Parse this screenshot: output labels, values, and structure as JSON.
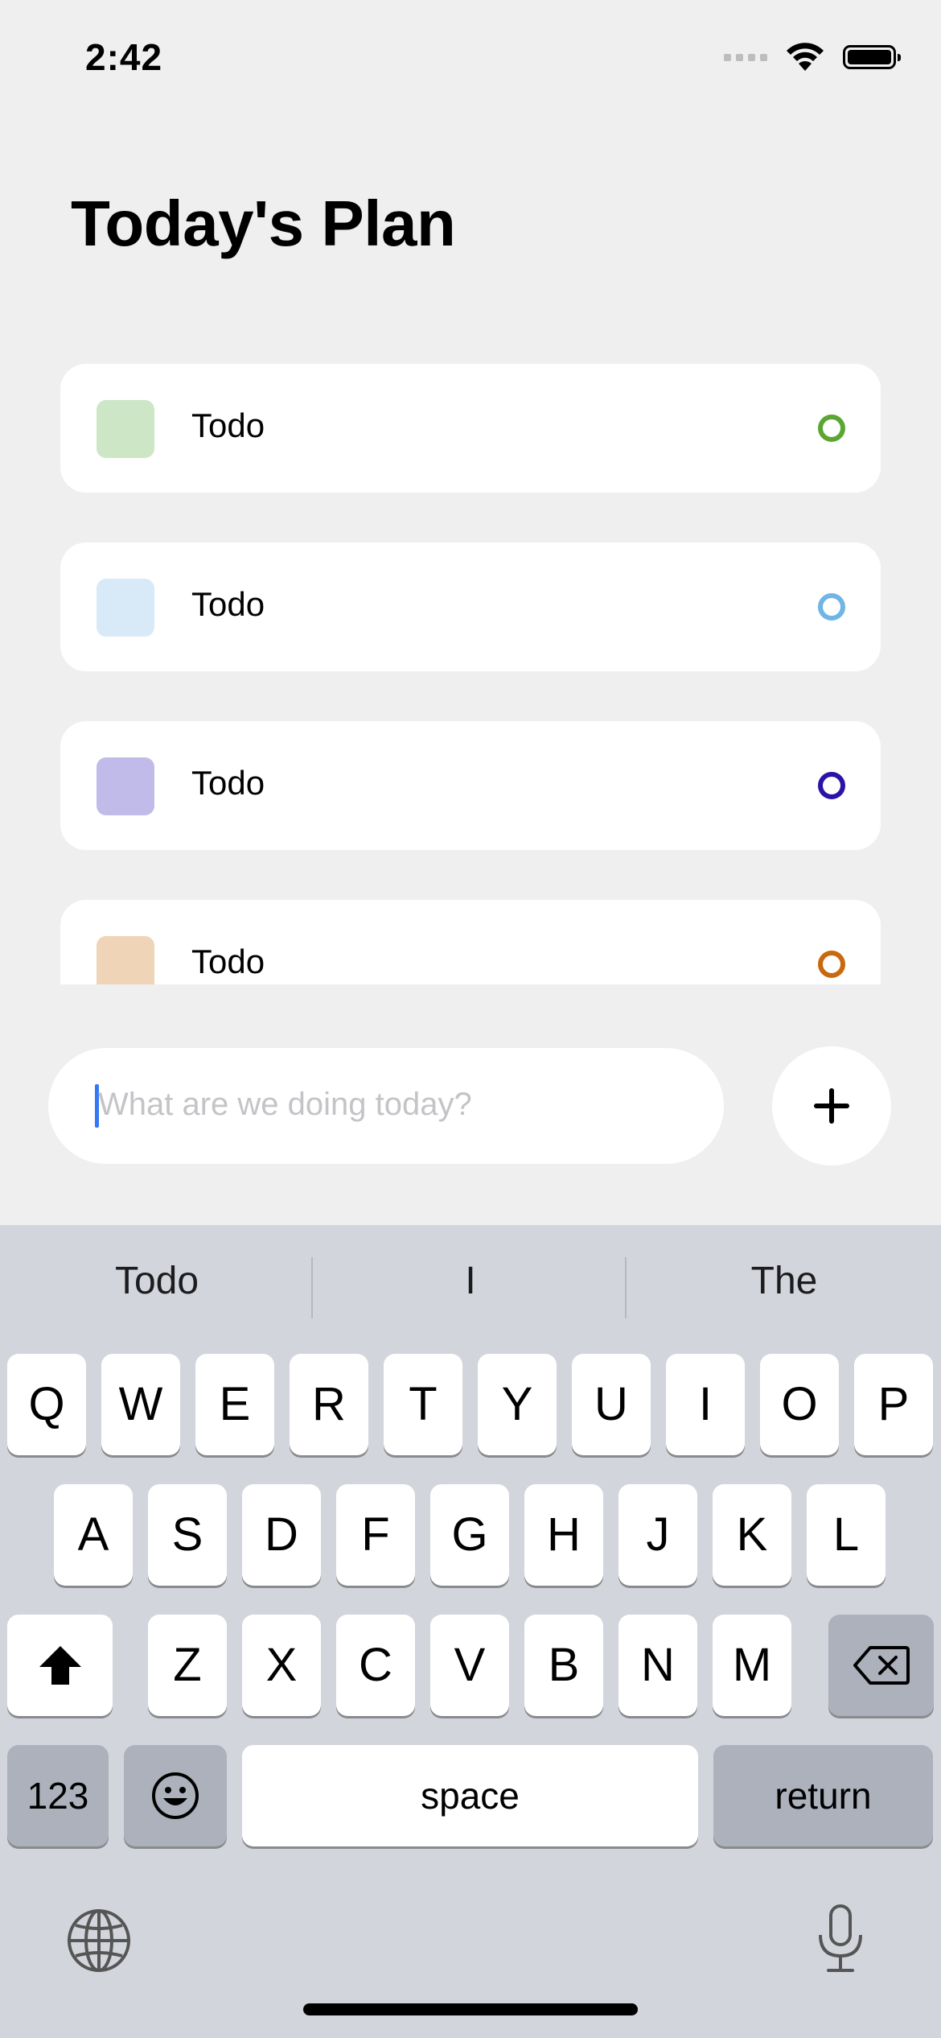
{
  "status_bar": {
    "time": "2:42"
  },
  "title": "Today's Plan",
  "todos": [
    {
      "label": "Todo",
      "swatch_color": "#CDE6C6",
      "ring_color": "#5BA632"
    },
    {
      "label": "Todo",
      "swatch_color": "#D8EAF8",
      "ring_color": "#6FB5E6"
    },
    {
      "label": "Todo",
      "swatch_color": "#C0BBE8",
      "ring_color": "#2A14A8"
    },
    {
      "label": "Todo",
      "swatch_color": "#EFD4B8",
      "ring_color": "#C9690E"
    }
  ],
  "input": {
    "placeholder": "What are we doing today?",
    "value": ""
  },
  "add_button": {
    "icon": "plus-icon"
  },
  "keyboard": {
    "suggestions": [
      "Todo",
      "I",
      "The"
    ],
    "row1": [
      "Q",
      "W",
      "E",
      "R",
      "T",
      "Y",
      "U",
      "I",
      "O",
      "P"
    ],
    "row2": [
      "A",
      "S",
      "D",
      "F",
      "G",
      "H",
      "J",
      "K",
      "L"
    ],
    "row3": [
      "Z",
      "X",
      "C",
      "V",
      "B",
      "N",
      "M"
    ],
    "numbers_label": "123",
    "space_label": "space",
    "return_label": "return",
    "icons": [
      "shift-icon",
      "delete-icon",
      "emoji-icon",
      "globe-icon",
      "microphone-icon"
    ]
  }
}
